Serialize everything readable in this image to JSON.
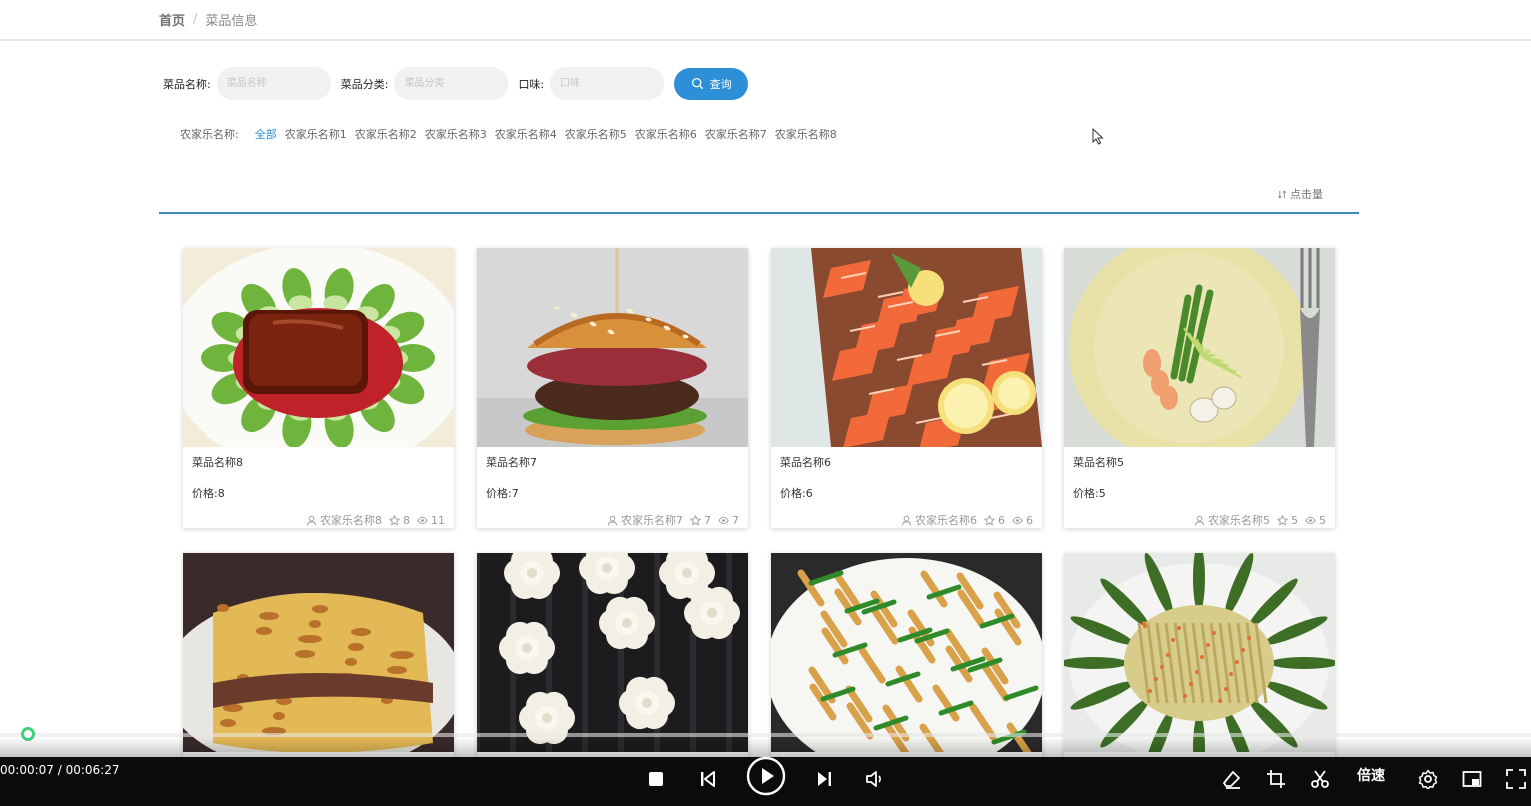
{
  "breadcrumb": {
    "home": "首页",
    "separator": "/",
    "current": "菜品信息"
  },
  "search": {
    "name_label": "菜品名称:",
    "name_placeholder": "菜品名称",
    "category_label": "菜品分类:",
    "category_placeholder": "菜品分类",
    "taste_label": "口味:",
    "taste_placeholder": "口味",
    "button_label": "查询"
  },
  "filter": {
    "label": "农家乐名称:",
    "options": [
      "全部",
      "农家乐名称1",
      "农家乐名称2",
      "农家乐名称3",
      "农家乐名称4",
      "农家乐名称5",
      "农家乐名称6",
      "农家乐名称7",
      "农家乐名称8"
    ],
    "active": "全部"
  },
  "sort": {
    "label": "点击量"
  },
  "dishes": [
    {
      "name": "菜品名称8",
      "price": "价格:8",
      "farm": "农家乐名称8",
      "stars": "8",
      "views": "11",
      "image": "braised-pork"
    },
    {
      "name": "菜品名称7",
      "price": "价格:7",
      "farm": "农家乐名称7",
      "stars": "7",
      "views": "7",
      "image": "burger"
    },
    {
      "name": "菜品名称6",
      "price": "价格:6",
      "farm": "农家乐名称6",
      "stars": "6",
      "views": "6",
      "image": "salmon-sashimi"
    },
    {
      "name": "菜品名称5",
      "price": "价格:5",
      "farm": "农家乐名称5",
      "stars": "5",
      "views": "5",
      "image": "shrimp-asparagus"
    },
    {
      "image": "egg-roll"
    },
    {
      "image": "flower-pastry"
    },
    {
      "image": "tofu-skin-stirfry"
    },
    {
      "image": "okra-plate"
    }
  ],
  "player": {
    "time": "00:00:07 / 00:06:27",
    "speed_label": "倍速",
    "progress": 0.018
  },
  "colors": {
    "accent": "#2d8fd5",
    "line": "#3e8ac1",
    "player_bg": "#0b0b0b"
  }
}
